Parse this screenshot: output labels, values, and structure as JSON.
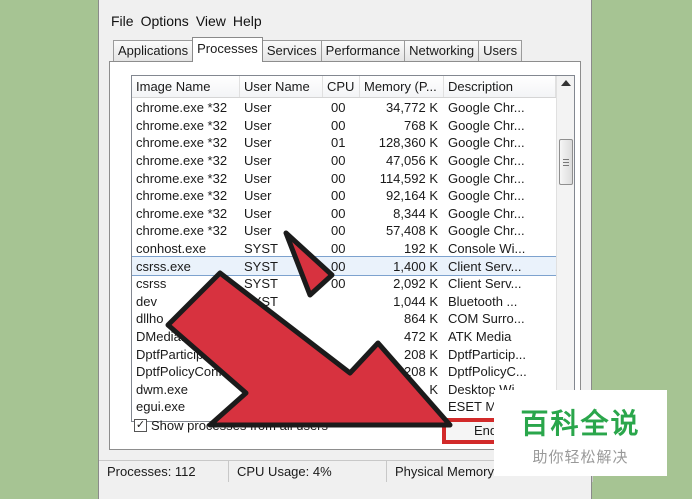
{
  "menu": [
    "File",
    "Options",
    "View",
    "Help"
  ],
  "tabs": [
    "Applications",
    "Processes",
    "Services",
    "Performance",
    "Networking",
    "Users"
  ],
  "active_tab": "Processes",
  "columns": [
    "Image Name",
    "User Name",
    "CPU",
    "Memory (P...",
    "Description"
  ],
  "processes": [
    {
      "name": "chrome.exe *32",
      "user": "User",
      "cpu": "00",
      "mem": "34,772 K",
      "desc": "Google Chr..."
    },
    {
      "name": "chrome.exe *32",
      "user": "User",
      "cpu": "00",
      "mem": "768 K",
      "desc": "Google Chr..."
    },
    {
      "name": "chrome.exe *32",
      "user": "User",
      "cpu": "01",
      "mem": "128,360 K",
      "desc": "Google Chr..."
    },
    {
      "name": "chrome.exe *32",
      "user": "User",
      "cpu": "00",
      "mem": "47,056 K",
      "desc": "Google Chr..."
    },
    {
      "name": "chrome.exe *32",
      "user": "User",
      "cpu": "00",
      "mem": "114,592 K",
      "desc": "Google Chr..."
    },
    {
      "name": "chrome.exe *32",
      "user": "User",
      "cpu": "00",
      "mem": "92,164 K",
      "desc": "Google Chr..."
    },
    {
      "name": "chrome.exe *32",
      "user": "User",
      "cpu": "00",
      "mem": "8,344 K",
      "desc": "Google Chr..."
    },
    {
      "name": "chrome.exe *32",
      "user": "User",
      "cpu": "00",
      "mem": "57,408 K",
      "desc": "Google Chr..."
    },
    {
      "name": "conhost.exe",
      "user": "SYST",
      "cpu": "00",
      "mem": "192 K",
      "desc": "Console Wi..."
    },
    {
      "name": "csrss.exe",
      "user": "SYST",
      "cpu": "00",
      "mem": "1,400 K",
      "desc": "Client Serv...",
      "selected": true
    },
    {
      "name": "csrss",
      "user": "SYST",
      "cpu": "00",
      "mem": "2,092 K",
      "desc": "Client Serv..."
    },
    {
      "name": "dev",
      "user": "SYST",
      "cpu": "",
      "mem": "1,044 K",
      "desc": "Bluetooth ..."
    },
    {
      "name": "dllho",
      "user": "",
      "cpu": "",
      "mem": "864 K",
      "desc": "COM Surro..."
    },
    {
      "name": "DMedia.exe",
      "user": "",
      "cpu": "",
      "mem": "472 K",
      "desc": "ATK Media"
    },
    {
      "name": "DptfParticipant",
      "user": "",
      "cpu": "",
      "mem": "208 K",
      "desc": "DptfParticip..."
    },
    {
      "name": "DptfPolicyConfi...",
      "user": "",
      "cpu": "",
      "mem": "208 K",
      "desc": "DptfPolicyC..."
    },
    {
      "name": "dwm.exe",
      "user": "",
      "cpu": "",
      "mem": "K",
      "desc": "Desktop Wi..."
    },
    {
      "name": "egui.exe",
      "user": "",
      "cpu": "",
      "mem": "",
      "desc": "ESET Ma..."
    }
  ],
  "show_all_label": "Show processes from all users",
  "show_all_checked": true,
  "end_button_label": "End",
  "status": {
    "processes": "Processes: 112",
    "cpu": "CPU Usage: 4%",
    "memory": "Physical Memory: 39%"
  },
  "watermark": {
    "title": "百科全说",
    "subtitle": "助你轻松解决"
  },
  "colors": {
    "background": "#a6c493",
    "arrow": "#d7323f",
    "end_border": "#d22a2a",
    "watermark_green": "#2aa64b"
  }
}
